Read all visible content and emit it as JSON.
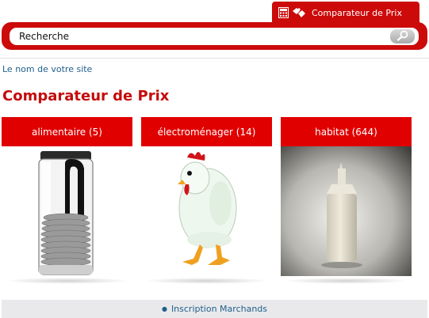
{
  "header": {
    "tab_label": "Comparateur de Prix",
    "icons": [
      "calculator-icon",
      "puzzle-icon"
    ]
  },
  "search": {
    "value": "Recherche",
    "button_icon": "magnifier-icon"
  },
  "site": {
    "link_text": "Le nom de votre site"
  },
  "page": {
    "title": "Comparateur de Prix"
  },
  "categories": [
    {
      "label": "alimentaire (5)",
      "image": "glass-storage-jar"
    },
    {
      "label": "électroménager (14)",
      "image": "chicken-egg-cooker"
    },
    {
      "label": "habitat (644)",
      "image": "squeeze-bottle"
    }
  ],
  "footer": {
    "link_text": "Inscription Marchands"
  },
  "colors": {
    "brand_red": "#cc0a0a",
    "category_red": "#e00000",
    "link_blue": "#1f5f8c"
  }
}
